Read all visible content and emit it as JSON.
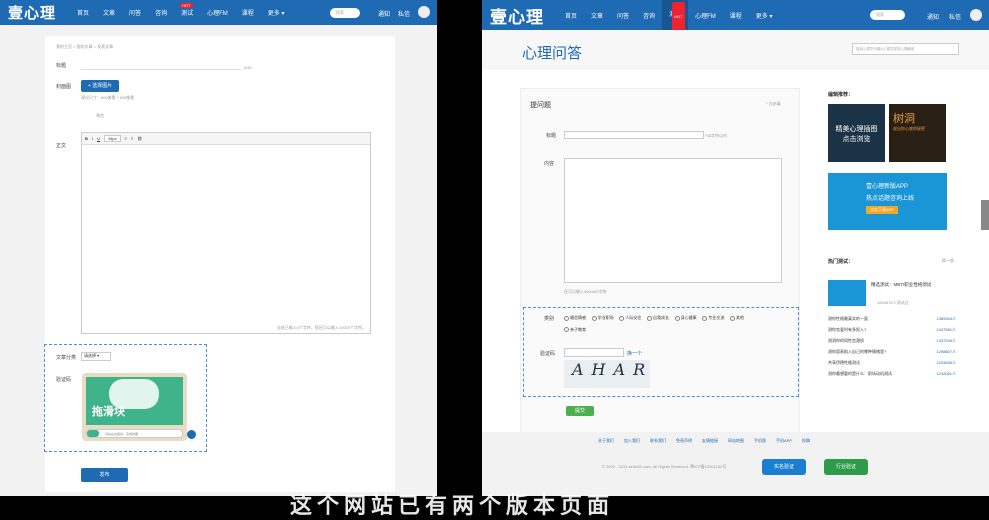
{
  "nav": {
    "logo": "壹心理",
    "items": [
      "首页",
      "文章",
      "问答",
      "咨询",
      "测试",
      "心理FM",
      "课程",
      "更多"
    ],
    "hot": "HOT",
    "search": "搜索",
    "notify": "通知",
    "msg": "私信"
  },
  "left": {
    "crumb": "我的主页 > 我的文章 > 发表文章",
    "title_label": "标题",
    "title_hint": "0/40",
    "cover_label": "封面图",
    "cover_btn": "+ 选择图片",
    "cover_note": "建议尺寸：600像素 * 400像素",
    "preview": "预览",
    "body_label": "正文",
    "editor_count": "当前已输入0个字符，您还可以输入10000个字符。",
    "category_label": "文章分类",
    "category_value": "请选择",
    "captcha_label": "验证码",
    "slider_text": "拖滑块",
    "slider_hint": "请往右边拖动，完成拼图",
    "publish": "发布",
    "font_size": "16px"
  },
  "right": {
    "page_title": "心理问答",
    "search_placeholder": "搜索心理学乐趣&心理发现的心理解惑",
    "form_title": "提问题",
    "required": "* 为必填",
    "q_title": "标题",
    "q_title_hint": "*30字符以内",
    "q_content": "内容",
    "q_content_hint": "还可以输入400/400字符",
    "category_label": "类别",
    "categories": [
      "婚恋情感",
      "学业职场",
      "人际交往",
      "自我成长",
      "身心健康",
      "专业交流",
      "其他",
      "亲子教育"
    ],
    "captcha_label": "验证码",
    "refresh": "换一个",
    "captcha_text": "AHAR",
    "submit": "提交",
    "recommend": "编辑推荐：",
    "ad1": "精美心理插图 点击浏览",
    "ad2_title": "树洞",
    "ad2_sub": "说出你心底的秘密",
    "app_line1": "壹心理新版APP",
    "app_line2": "热点话题咨询上线",
    "app_btn": "点击下载APP",
    "hot_tests": "热门测试：",
    "hot_more": "换一换",
    "featured": "精选测试：MBTI职业性格测试",
    "featured_count": "1693678人测试过",
    "tests": [
      {
        "name": "测你性格最真实的一面",
        "count": "1389454人"
      },
      {
        "name": "测你恋爱时有多投入?",
        "count": "1347581人"
      },
      {
        "name": "测测你的同性恋潜质",
        "count": "1337249人"
      },
      {
        "name": "测你容易陷入自己的哪种情绪里?",
        "count": "1298807人"
      },
      {
        "name": "共享伊德性格测试",
        "count": "1293636人"
      },
      {
        "name": "测你最想要的是什么：职场动机测试",
        "count": "1242051人"
      }
    ],
    "footer_links": [
      "关于我们",
      "加入我们",
      "联系我们",
      "免责声明",
      "友情链接",
      "网站地图",
      "手机版",
      "手机APP",
      "投稿"
    ],
    "copyright": "© 2005 - 2014  xinli001.com. All Rights Reserved.  粤ICP备12001152号",
    "badge1": "实名验证",
    "badge2": "行业验证"
  },
  "caption": "这个网站已有两个版本页面"
}
